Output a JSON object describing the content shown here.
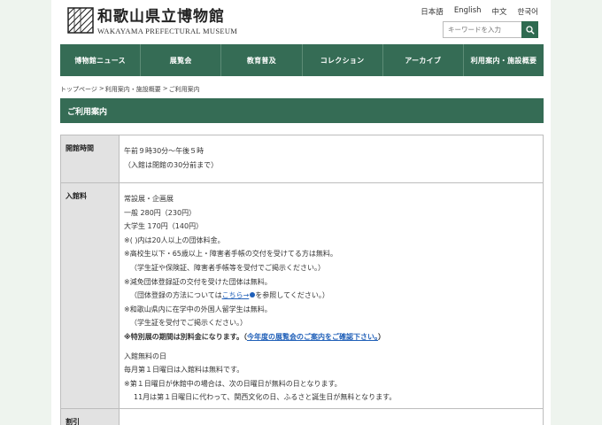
{
  "header": {
    "logo_title": "和歌山県立博物館",
    "logo_subtitle": "WAKAYAMA PREFECTURAL MUSEUM",
    "languages": [
      "日本語",
      "English",
      "中文",
      "한국어"
    ],
    "search_placeholder": "キーワードを入力"
  },
  "nav": {
    "items": [
      "博物館ニュース",
      "展覧会",
      "教育普及",
      "コレクション",
      "アーカイブ",
      "利用案内・施設概要"
    ]
  },
  "breadcrumb": {
    "items": [
      "トップページ",
      "利用案内・施設概要",
      "ご利用案内"
    ],
    "separator": ">"
  },
  "page_title": "ご利用案内",
  "hours": {
    "header": "開館時間",
    "line1": "午前９時30分〜午後５時",
    "line2": "（入館は閉館の30分前まで）"
  },
  "admission": {
    "header": "入館料",
    "category": "常設展・企画展",
    "general": "一般 280円（230円）",
    "student": "大学生 170円（140円）",
    "group_note": "※( )内は20人以上の団体料金。",
    "free_note1": "※高校生以下・65歳以上・障害者手帳の交付を受けてる方は無料。",
    "free_note1_sub": "（学生証や保険証、障害者手帳等を受付でご掲示ください。）",
    "reduce_note": "※減免団体登録証の交付を受けた団体は無料。",
    "reduce_sub_prefix": "（団体登録の方法については",
    "reduce_sub_link": "こちら→",
    "reduce_sub_suffix": "を参照してください。）",
    "foreign_note": "※和歌山県内に在学中の外国人留学生は無料。",
    "foreign_sub": "（学生証を受付でご掲示ください。）",
    "special_prefix": "※特別展の期間は別料金になります。（",
    "special_link": "今年度の展覧会のご案内をご確認下さい。",
    "special_suffix": "）",
    "free_day_title": "入館無料の日",
    "free_day_line": "毎月第１日曜日は入館料は無料です。",
    "free_day_note": "※第１日曜日が休館中の場合は、次の日曜日が無料の日となります。",
    "free_day_note2": "11月は第１日曜日に代わって、関西文化の日、ふるさと誕生日が無料となります。"
  },
  "discount": {
    "header": "割引"
  },
  "colors": {
    "brand_green": "#356c55",
    "link_blue": "#1f5fb8",
    "page_background": "#eef4ee"
  }
}
